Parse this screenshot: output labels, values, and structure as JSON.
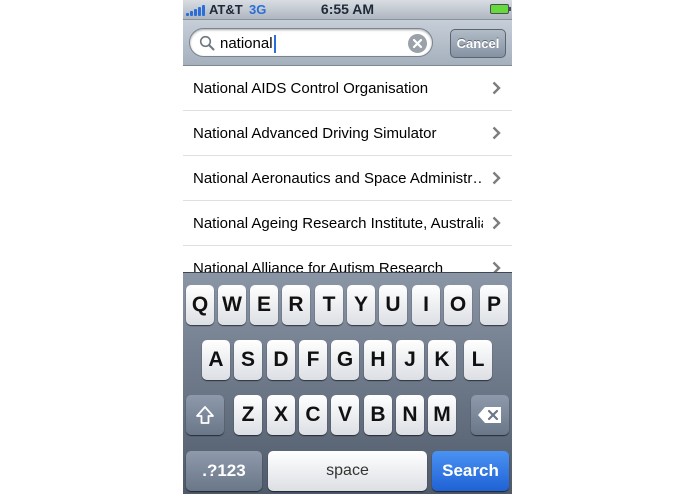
{
  "status_bar": {
    "carrier": "AT&T",
    "network": "3G",
    "time": "6:55 AM"
  },
  "search": {
    "query": "national",
    "cancel_label": "Cancel"
  },
  "results": [
    {
      "label": "National AIDS Control Organisation"
    },
    {
      "label": "National Advanced Driving Simulator"
    },
    {
      "label": "National Aeronautics and Space Administr…"
    },
    {
      "label": "National Ageing Research Institute, Australia"
    },
    {
      "label": "National Alliance for Autism Research"
    }
  ],
  "keyboard": {
    "row1": [
      "Q",
      "W",
      "E",
      "R",
      "T",
      "Y",
      "U",
      "I",
      "O",
      "P"
    ],
    "row2": [
      "A",
      "S",
      "D",
      "F",
      "G",
      "H",
      "J",
      "K",
      "L"
    ],
    "row3": [
      "Z",
      "X",
      "C",
      "V",
      "B",
      "N",
      "M"
    ],
    "numbers_label": ".?123",
    "space_label": "space",
    "search_label": "Search"
  },
  "colors": {
    "accent": "#2b6fd6",
    "search_key": "#1f62d6"
  }
}
